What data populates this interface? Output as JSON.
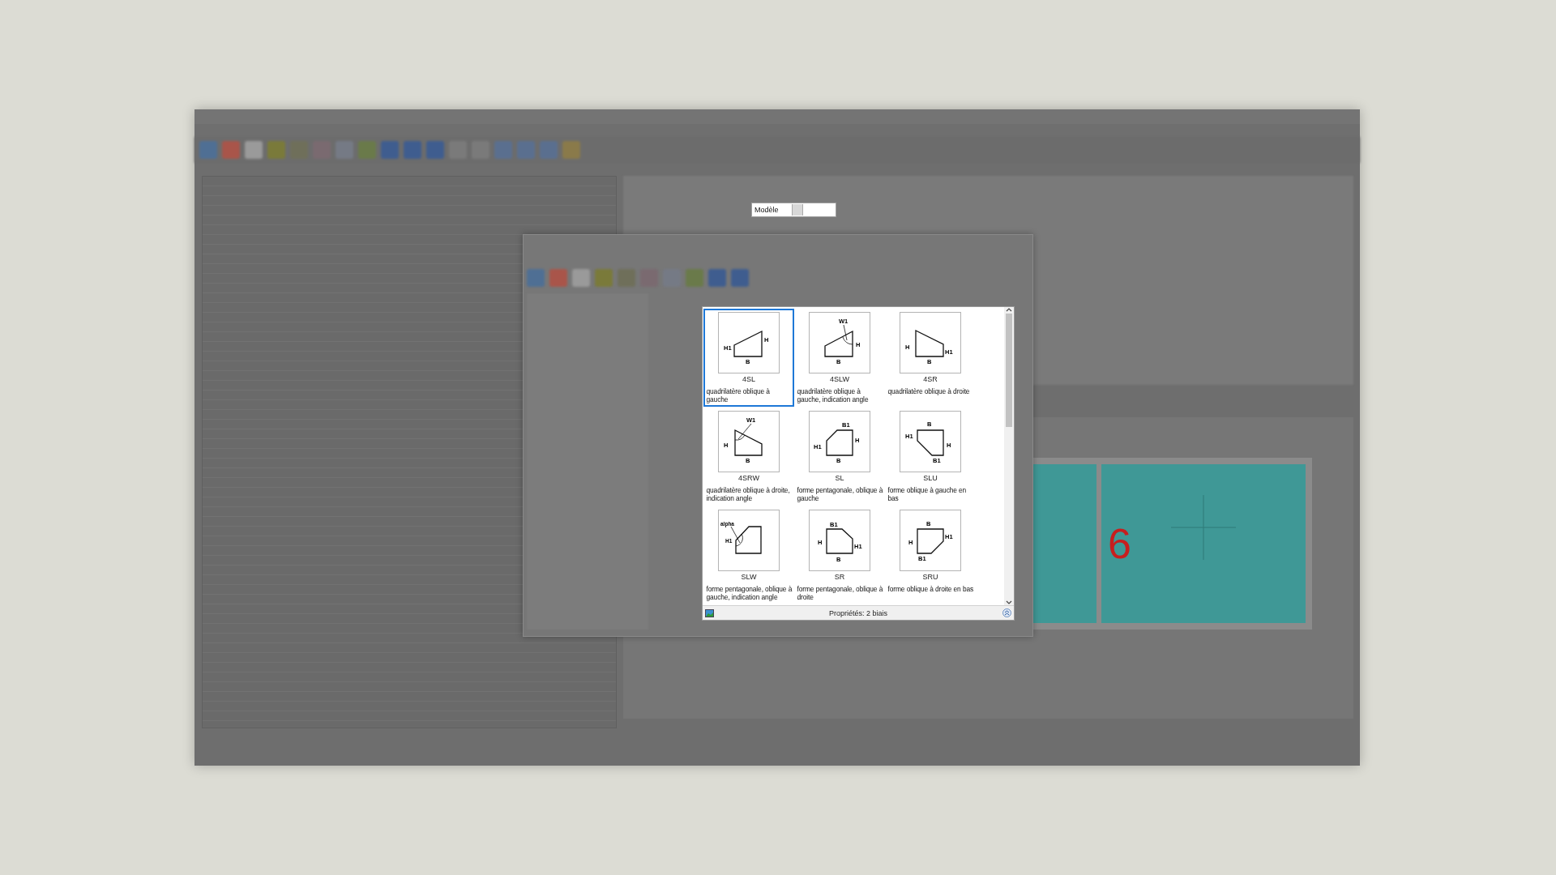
{
  "model_field": {
    "label": "Modèle"
  },
  "drawing": {
    "position_number": "6"
  },
  "shape_picker": {
    "items": [
      {
        "code": "4SL",
        "description": "quadrilatère oblique à gauche",
        "kind": "quad-left",
        "dims": [
          "H1",
          "H",
          "B"
        ],
        "selected": true
      },
      {
        "code": "4SLW",
        "description": "quadrilatère oblique à gauche, indication angle",
        "kind": "quad-left-angle",
        "dims": [
          "W1",
          "H",
          "B"
        ],
        "selected": false
      },
      {
        "code": "4SR",
        "description": "quadrilatère oblique à droite",
        "kind": "quad-right",
        "dims": [
          "H",
          "H1",
          "B"
        ],
        "selected": false
      },
      {
        "code": "4SRW",
        "description": "quadrilatère oblique à droite, indication angle",
        "kind": "quad-right-angle",
        "dims": [
          "W1",
          "H",
          "B"
        ],
        "selected": false
      },
      {
        "code": "SL",
        "description": "forme pentagonale, oblique à gauche",
        "kind": "pent-left",
        "dims": [
          "B1",
          "H",
          "H1",
          "B"
        ],
        "selected": false
      },
      {
        "code": "SLU",
        "description": "forme oblique à gauche en bas",
        "kind": "pent-left-low",
        "dims": [
          "B",
          "H1",
          "H",
          "B1"
        ],
        "selected": false
      },
      {
        "code": "SLW",
        "description": "forme pentagonale, oblique à gauche, indication angle",
        "kind": "pent-left-angle",
        "dims": [
          "alpha",
          "H1"
        ],
        "selected": false
      },
      {
        "code": "SR",
        "description": "forme pentagonale, oblique à droite",
        "kind": "pent-right",
        "dims": [
          "B1",
          "H",
          "H1",
          "B"
        ],
        "selected": false
      },
      {
        "code": "SRU",
        "description": "forme oblique à droite en bas",
        "kind": "pent-right-low",
        "dims": [
          "B",
          "H1",
          "H",
          "B1"
        ],
        "selected": false
      }
    ],
    "footer": "Propriétés: 2 biais"
  }
}
